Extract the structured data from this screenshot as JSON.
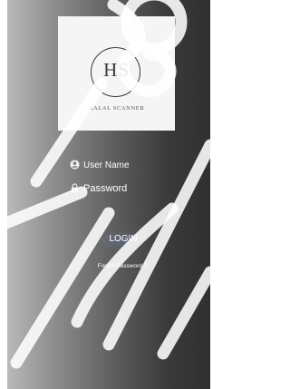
{
  "app": {
    "logo": {
      "mark": "HS",
      "name": "HALAL SCANNER"
    }
  },
  "login_form": {
    "username": {
      "placeholder": "User Name",
      "icon": "user-circle-icon"
    },
    "password": {
      "placeholder": "Password",
      "icon": "lock-icon"
    },
    "login_label": "LOGIN",
    "forgot_label": "Forgot Password ?"
  },
  "colors": {
    "logo_card": "#f5f5f5",
    "text": "#ffffff",
    "logo_ink": "#3a3a3a"
  }
}
